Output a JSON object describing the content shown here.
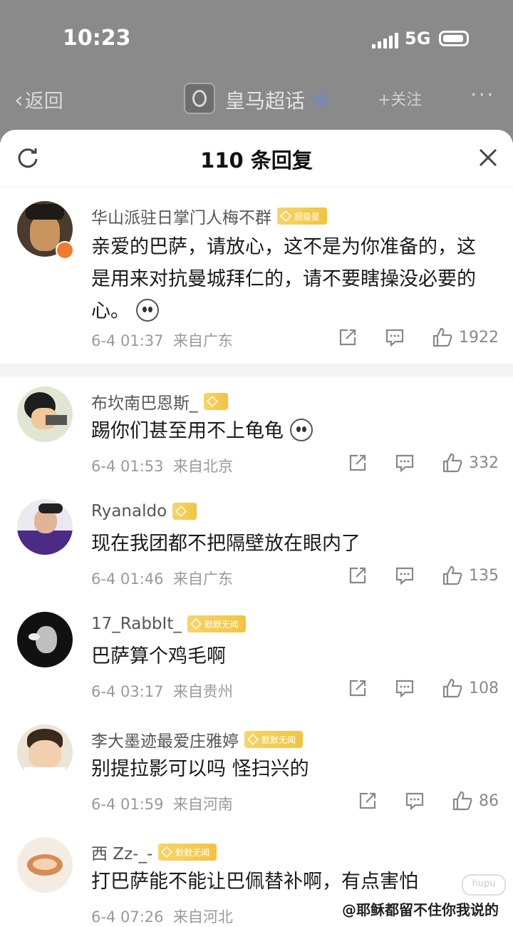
{
  "status_bar": {
    "time": "10:23",
    "network": "5G"
  },
  "nav": {
    "back_label": "返回",
    "title": "皇马超话",
    "follow_label": "+关注",
    "more": "···"
  },
  "sheet": {
    "title": "110 条回复"
  },
  "replies": [
    {
      "username": "华山派驻日掌门人梅不群",
      "badge": "超级星",
      "badge_level": "6",
      "content": "亲爱的巴萨，请放心，这不是为你准备的，这是用来对抗曼城拜仁的，请不要瞎操没必要的心。",
      "has_emoji": true,
      "date": "6-4 01:37",
      "location": "来自广东",
      "likes": "1922"
    },
    {
      "username": "布坎南巴恩斯_",
      "badge": "",
      "badge_level": "7",
      "content": "踢你们甚至用不上龟龟",
      "has_emoji": true,
      "date": "6-4 01:53",
      "location": "来自北京",
      "likes": "332"
    },
    {
      "username": "Ryanaldo",
      "badge": "",
      "badge_level": "9",
      "content": "现在我团都不把隔壁放在眼内了",
      "has_emoji": false,
      "date": "6-4 01:46",
      "location": "来自广东",
      "likes": "135"
    },
    {
      "username": "17_RabbIt_",
      "badge": "默默无闻",
      "badge_level": "1",
      "content": "巴萨算个鸡毛啊",
      "has_emoji": false,
      "date": "6-4 03:17",
      "location": "来自贵州",
      "likes": "108"
    },
    {
      "username": "李大墨迹最爱庄雅婷",
      "badge": "默默无闻",
      "badge_level": "1",
      "content": "别提拉影可以吗 怪扫兴的",
      "has_emoji": false,
      "date": "6-4 01:59",
      "location": "来自河南",
      "likes": "86"
    },
    {
      "username": "西 Zz-_-",
      "badge": "默默无闻",
      "badge_level": "1",
      "content": "打巴萨能不能让巴佩替补啊，有点害怕",
      "has_emoji": false,
      "date": "6-4 07:26",
      "location": "来自河北",
      "likes": ""
    }
  ],
  "watermark": "@耶稣都留不住你我说的",
  "hupu_mark": "hupu",
  "colors": {
    "badge_gold": "#f3c340",
    "meta_gray": "#999999",
    "sheet_bg": "#ffffff"
  }
}
